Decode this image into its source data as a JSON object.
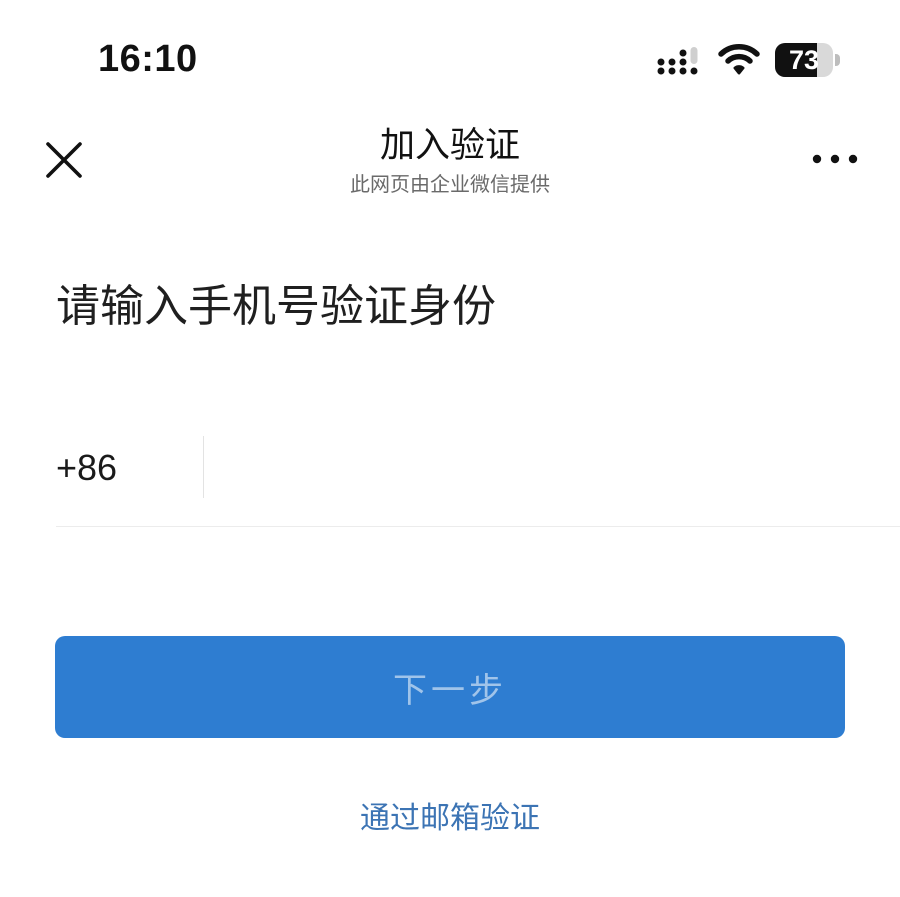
{
  "status_bar": {
    "time": "16:10",
    "battery_level": "73",
    "battery_fraction": 0.73,
    "icons": [
      "cellular-signal-icon",
      "wifi-icon",
      "battery-icon"
    ]
  },
  "nav": {
    "close_icon": "close-icon",
    "title": "加入验证",
    "subtitle": "此网页由企业微信提供",
    "more_icon": "more-dots-icon"
  },
  "form": {
    "heading": "请输入手机号验证身份",
    "country_code": "+86",
    "phone_value": "",
    "phone_placeholder": ""
  },
  "actions": {
    "next_label": "下一步",
    "email_link_label": "通过邮箱验证"
  },
  "colors": {
    "primary_button": "#2e7dd1",
    "link": "#3c74b4",
    "divider": "#ececec"
  }
}
